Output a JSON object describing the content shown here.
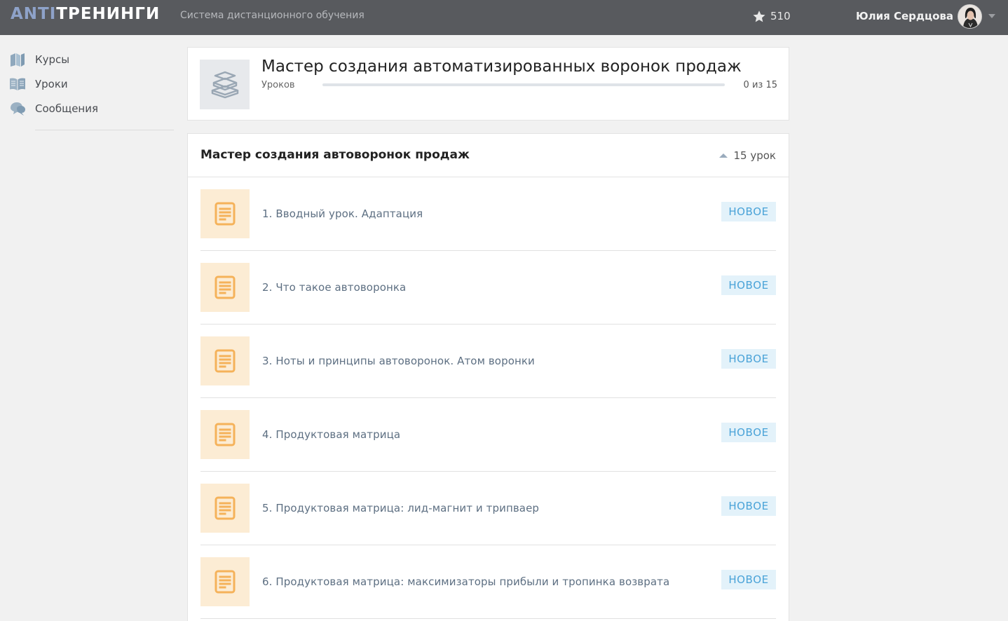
{
  "header": {
    "logo_part1": "ANTI",
    "logo_part2": "ТРЕНИНГИ",
    "subtitle": "Система дистанционного обучения",
    "points": "510",
    "points_icon": "star-icon",
    "user_name": "Юлия Сердцова",
    "dropdown_icon": "caret-down-icon"
  },
  "sidebar": {
    "items": [
      {
        "label": "Курсы",
        "icon": "courses-icon"
      },
      {
        "label": "Уроки",
        "icon": "lessons-icon"
      },
      {
        "label": "Сообщения",
        "icon": "messages-icon"
      }
    ]
  },
  "course": {
    "title": "Мастер создания автоматизированных воронок продаж",
    "lessons_label": "Уроков",
    "progress_text": "0 из 15",
    "progress_fraction": 0,
    "icon": "books-icon"
  },
  "module": {
    "title": "Мастер создания автоворонок продаж",
    "count": "15 урок",
    "toggle_icon": "collapse-up-icon"
  },
  "lessons": [
    {
      "title": "1. Вводный урок. Адаптация",
      "badge": "НОВОЕ"
    },
    {
      "title": "2. Что такое автоворонка",
      "badge": "НОВОЕ"
    },
    {
      "title": "3. Ноты и принципы автоворонок. Атом воронки",
      "badge": "НОВОЕ"
    },
    {
      "title": "4. Продуктовая матрица",
      "badge": "НОВОЕ"
    },
    {
      "title": "5. Продуктовая матрица: лид-магнит и трипваер",
      "badge": "НОВОЕ"
    },
    {
      "title": "6. Продуктовая матрица: максимизаторы прибыли и тропинка возврата",
      "badge": "НОВОЕ"
    }
  ],
  "colors": {
    "topbar": "#585a5e",
    "logo_accent": "#8ea2c9",
    "badge_text": "#4aa3d8",
    "badge_bg": "#e3f2fa",
    "lesson_icon": "#f5b25a",
    "lesson_thumb_bg": "#fcecd4"
  }
}
